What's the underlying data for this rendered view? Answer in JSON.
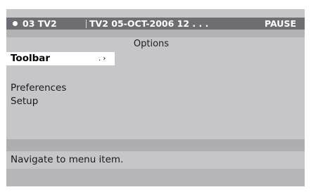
{
  "status_bar": {
    "channel": "03 TV2",
    "info": "TV2   05-OCT-2006   12 . . .",
    "mode": "PAUSE"
  },
  "menu": {
    "title": "Options",
    "selected_item": "Toolbar",
    "submenu_arrow": ". ›",
    "items": [
      "Preferences",
      "Setup"
    ]
  },
  "help_text": "Navigate to menu item.",
  "colors": {
    "screen_bg": "#c6c6c8",
    "status_bar_bg": "#6e6e72",
    "highlight_bg": "#ffffff"
  }
}
